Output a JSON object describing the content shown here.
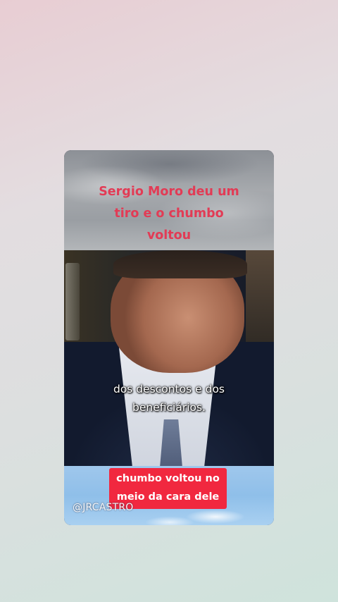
{
  "video_card": {
    "title_lines": [
      "Sergio Moro deu um",
      "tiro e o chumbo",
      "voltou"
    ],
    "subtitle_lines": [
      "dos descontos e dos",
      "beneficiários."
    ],
    "overlay_lines": [
      "chumbo voltou no",
      "meio da cara dele"
    ],
    "watermark": "@JRCASTRO"
  },
  "colors": {
    "title": "#e23b55",
    "overlay_box": "#f1283f",
    "caption": "#ffffff"
  }
}
